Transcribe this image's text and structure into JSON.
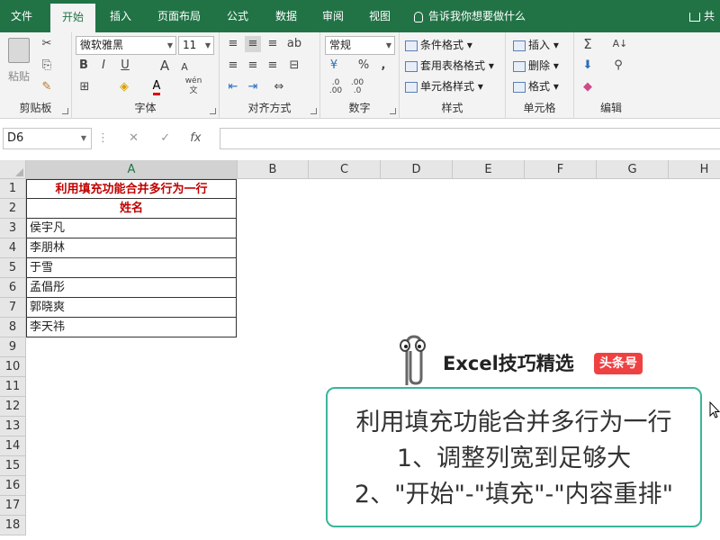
{
  "tabs": [
    "文件",
    "开始",
    "插入",
    "页面布局",
    "公式",
    "数据",
    "审阅",
    "视图"
  ],
  "active_tab": "开始",
  "tell_me": "告诉我你想要做什么",
  "share": "共",
  "clipboard": {
    "paste": "粘贴",
    "label": "剪贴板"
  },
  "font": {
    "name": "微软雅黑",
    "size": "11",
    "label": "字体",
    "bold": "B",
    "italic": "I",
    "underline": "U",
    "grow": "A",
    "shrink": "A",
    "wen": "wén"
  },
  "alignment": {
    "label": "对齐方式"
  },
  "number": {
    "format": "常规",
    "label": "数字",
    "percent": "%",
    "comma": ","
  },
  "styles": {
    "cond": "条件格式",
    "table": "套用表格格式",
    "cell": "单元格样式",
    "label": "样式"
  },
  "cells": {
    "insert": "插入",
    "delete": "删除",
    "format": "格式",
    "label": "单元格"
  },
  "editing": {
    "label": "编辑"
  },
  "name_box": "D6",
  "fx": "fx",
  "columns": [
    "A",
    "B",
    "C",
    "D",
    "E",
    "F",
    "G",
    "H"
  ],
  "selected_column": "A",
  "rows": [
    "1",
    "2",
    "3",
    "4",
    "5",
    "6",
    "7",
    "8",
    "9",
    "10",
    "11",
    "12",
    "13",
    "14",
    "15",
    "16",
    "17",
    "18"
  ],
  "cells_a": [
    "利用填充功能合并多行为一行",
    "姓名",
    "侯宇凡",
    "李朋林",
    "于雪",
    "孟倡彤",
    "郭晓爽",
    "李天祎"
  ],
  "brand": {
    "name": "Excel技巧精选",
    "badge": "头条号"
  },
  "callout": [
    "利用填充功能合并多行为一行",
    "1、调整列宽到足够大",
    "2、\"开始\"-\"填充\"-\"内容重排\""
  ]
}
